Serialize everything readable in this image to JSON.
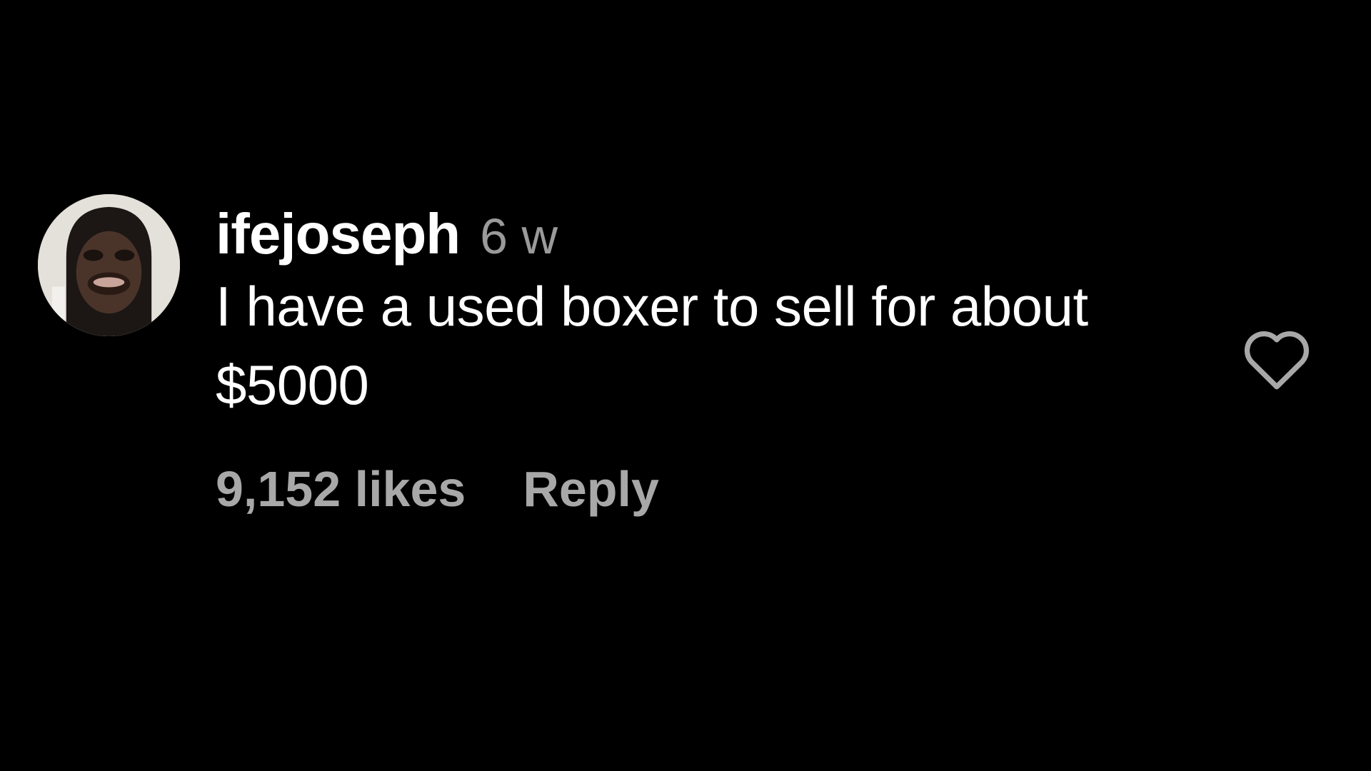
{
  "comment": {
    "username": "ifejoseph",
    "timestamp": "6 w",
    "text": "I have a used boxer to sell for about $5000",
    "likes": "9,152 likes",
    "reply_label": "Reply"
  },
  "icons": {
    "like": "heart-outline-icon",
    "avatar": "user-avatar"
  },
  "colors": {
    "background": "#000000",
    "primary_text": "#ffffff",
    "secondary_text": "#a8a8a8"
  }
}
